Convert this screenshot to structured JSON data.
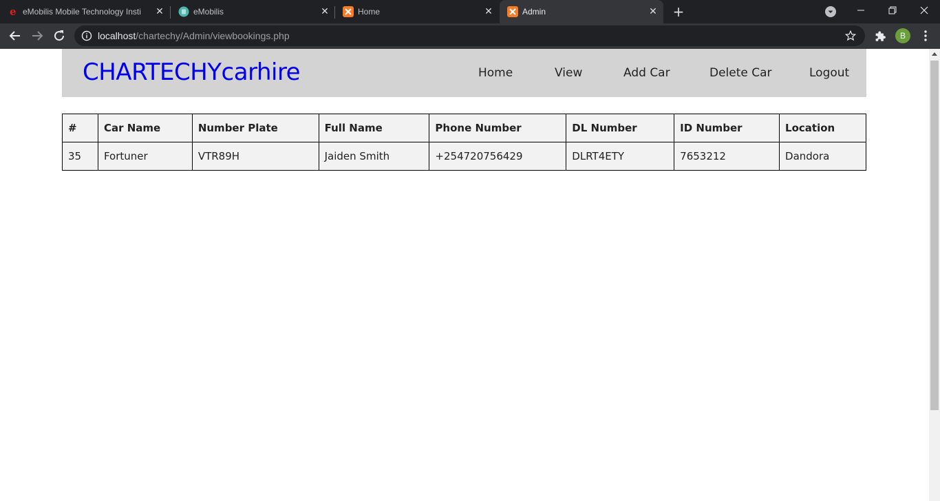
{
  "browser": {
    "tabs": [
      {
        "title": "eMobilis Mobile Technology Insti",
        "active": false
      },
      {
        "title": "eMobilis",
        "active": false
      },
      {
        "title": "Home",
        "active": false
      },
      {
        "title": "Admin",
        "active": true
      }
    ],
    "address": {
      "host": "localhost",
      "path": "/chartechy/Admin/viewbookings.php"
    },
    "profile_initial": "B"
  },
  "site": {
    "brand": "CHARTECHYcarhire",
    "nav": [
      "Home",
      "View",
      "Add Car",
      "Delete Car",
      "Logout"
    ]
  },
  "bookings": {
    "headers": [
      "#",
      "Car Name",
      "Number Plate",
      "Full Name",
      "Phone Number",
      "DL Number",
      "ID Number",
      "Location"
    ],
    "rows": [
      [
        "35",
        "Fortuner",
        "VTR89H",
        "Jaiden Smith",
        "+254720756429",
        "DLRT4ETY",
        "7653212",
        "Dandora"
      ]
    ]
  },
  "colors": {
    "brand": "#0000ee",
    "header_bg": "#d3d3d3",
    "table_bg": "#f2f2f2"
  }
}
